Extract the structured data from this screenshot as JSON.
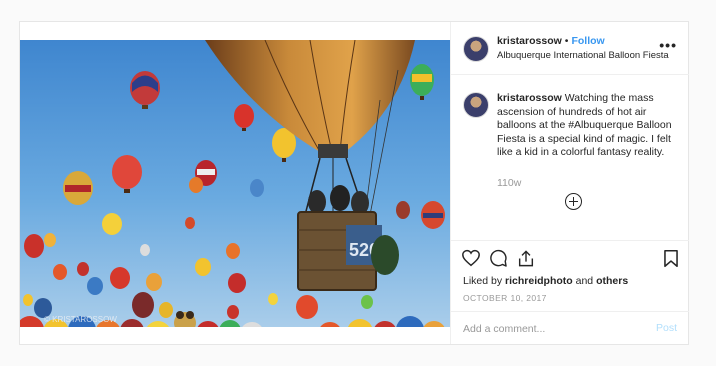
{
  "post": {
    "username": "kristarossow",
    "dot": "•",
    "follow_label": "Follow",
    "location": "Albuquerque International Balloon Fiesta",
    "more_label": "•••",
    "caption_text": "Watching the mass ascension of hundreds of hot air balloons at the #Albuquerque Balloon Fiesta is a special kind of magic. I felt like a kid in a colorful fantasy reality.",
    "time_ago": "110w",
    "liked_by_prefix": "Liked by ",
    "liked_by_user": "richreidphoto",
    "liked_by_suffix": " and ",
    "liked_by_others": "others",
    "date": "OCTOBER 10, 2017",
    "comment_placeholder": "Add a comment...",
    "post_label": "Post",
    "photo_watermark": "© KRISTAROSSOW",
    "basket_number": "520"
  },
  "icons": [
    "heart-icon",
    "comment-icon",
    "share-icon",
    "bookmark-icon",
    "load-more-icon",
    "more-options-icon"
  ],
  "colors": {
    "link": "#3897f0",
    "muted": "#999999",
    "border": "#efefef",
    "sky": "#5a9bd6"
  }
}
